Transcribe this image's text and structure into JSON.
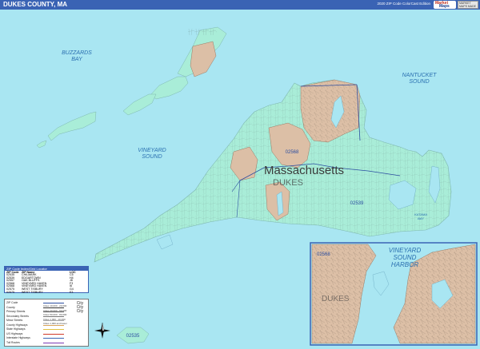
{
  "header": {
    "title": "DUKES COUNTY, MA",
    "edition": "2020 ZIP Code ColorCast Edition",
    "logo_line1": "Market",
    "logo_line2": "Maps",
    "badge_text": "MARKET MAPS MADE"
  },
  "map": {
    "state_label": "Massachusetts",
    "county_label": "DUKES",
    "colors": {
      "water": "#a9e6f2",
      "land": "#a9edd8",
      "zip_tan": "#dcbfa6",
      "header": "#3a63b4",
      "zip_boundary": "#2b4da0"
    },
    "water_labels": [
      {
        "line1": "BUZZARDS",
        "line2": "BAY"
      },
      {
        "line1": "NANTUCKET",
        "line2": "SOUND"
      },
      {
        "line1": "VINEYARD",
        "line2": "SOUND"
      },
      {
        "line1": "KATAMA",
        "line2": "BAY"
      }
    ],
    "zip_labels": [
      "02568",
      "02539",
      "02535"
    ]
  },
  "inset": {
    "title_line1": "VINEYARD",
    "title_line2": "SOUND",
    "title_line3": "HARBOR",
    "zip_label": "02568",
    "county_label": "DUKES"
  },
  "legend": {
    "header": "ZIP Code Index/Grid Locator",
    "columns": [
      "ZIP Code",
      "ZIP Name",
      "LOC"
    ],
    "rows": [
      [
        "02535",
        "CHILMARK",
        "C5"
      ],
      [
        "02539",
        "EDGARTOWN",
        "H4"
      ],
      [
        "02557",
        "OAK BLUFFS",
        "J8"
      ],
      [
        "02568",
        "VINEYARD HAVEN",
        "F3"
      ],
      [
        "02568",
        "VINEYARD HAVEN",
        "I6"
      ],
      [
        "02575",
        "WEST TISBURY",
        "G4"
      ],
      [
        "02575",
        "WEST TISBURY",
        "E3"
      ]
    ]
  },
  "key": {
    "items": [
      "ZIP Code",
      "County",
      "Primary Streets",
      "Secondary Streets",
      "Minor Streets",
      "County Highways",
      "State Highways",
      "US Highways",
      "Interstate Highways",
      "Toll Routes"
    ],
    "ranges": [
      "Cities 10,000 - 20,000",
      "Cities 20,000 - 50,000",
      "Cities 50,000 - 80,000",
      "Cities 1,000 - 10,000",
      "Cities 1,000 and fewer"
    ],
    "city_icons": [
      "City",
      "City",
      "City"
    ]
  }
}
